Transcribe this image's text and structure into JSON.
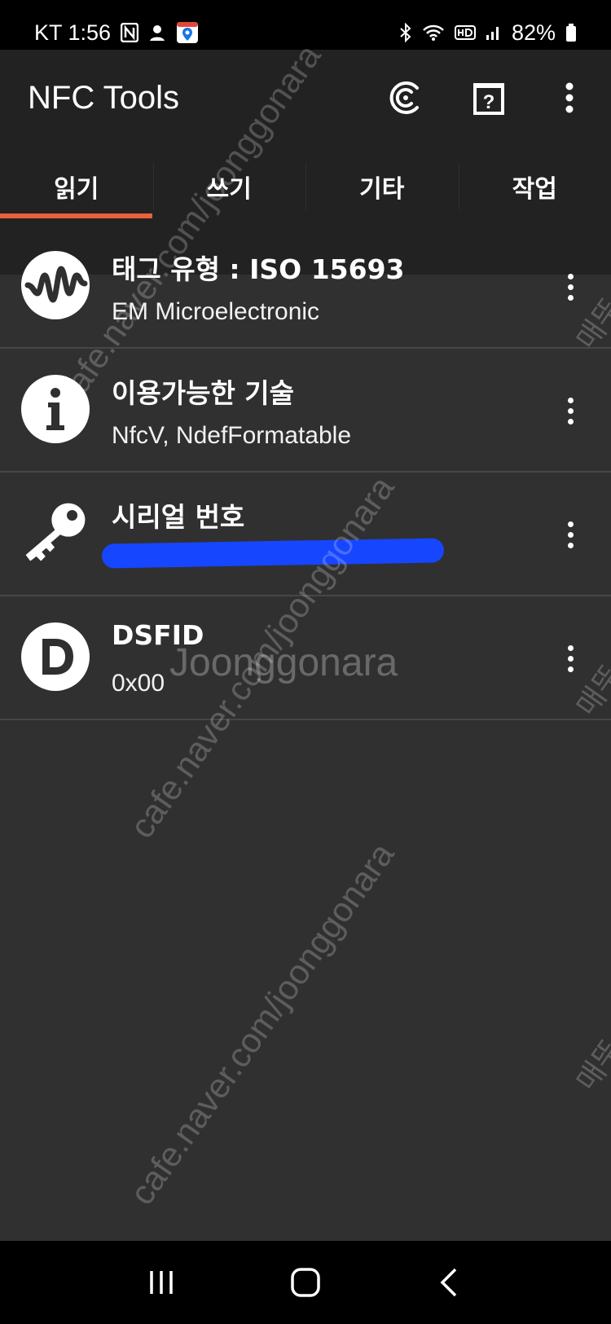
{
  "status_bar": {
    "carrier_time": "KT 1:56",
    "battery": "82%",
    "icons": [
      "nfc-icon",
      "notification-icon",
      "maps-icon",
      "bluetooth-icon",
      "wifi-icon",
      "hd-icon",
      "signal-icon",
      "battery-icon"
    ]
  },
  "app": {
    "title": "NFC Tools",
    "toolbar_icons": [
      "history-icon",
      "help-icon",
      "overflow-menu-icon"
    ]
  },
  "tabs": [
    {
      "label": "읽기",
      "selected": true
    },
    {
      "label": "쓰기",
      "selected": false
    },
    {
      "label": "기타",
      "selected": false
    },
    {
      "label": "작업",
      "selected": false
    }
  ],
  "accent_color": "#e8613a",
  "rows": [
    {
      "icon": "wave-icon",
      "title": "태그 유형 : ISO 15693",
      "value": "EM Microelectronic"
    },
    {
      "icon": "info-icon",
      "title": "이용가능한 기술",
      "value": "NfcV, NdefFormatable"
    },
    {
      "icon": "key-icon",
      "title": "시리얼 번호",
      "value": "",
      "redacted": true
    },
    {
      "icon": "d-letter-icon",
      "title": "DSFID",
      "value": "0x00"
    }
  ],
  "watermarks": {
    "url": "cafe.naver.com/joonggonara",
    "brand": "Joonggonara",
    "side": "매뚜"
  },
  "nav_bar": [
    "recents-button",
    "home-button",
    "back-button"
  ]
}
